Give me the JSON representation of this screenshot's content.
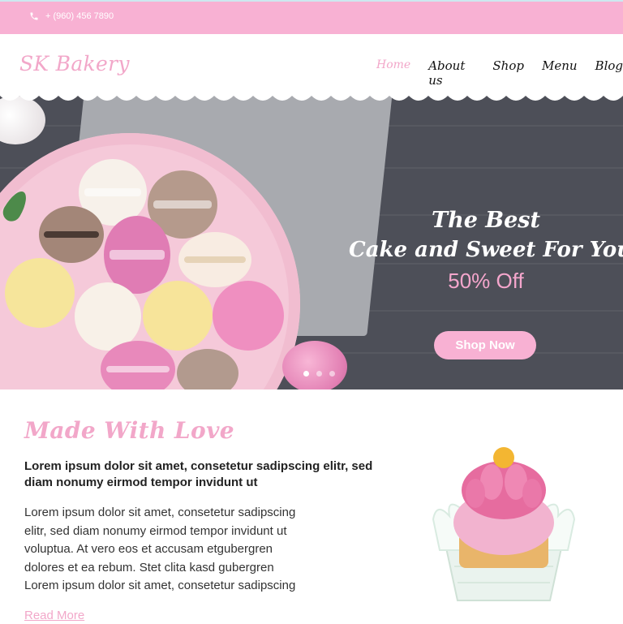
{
  "topbar": {
    "phone": "+ (960) 456 7890",
    "phone_icon": "phone-icon",
    "bg_color": "#f8b1d3"
  },
  "header": {
    "logo": "SK Bakery",
    "nav": [
      {
        "label": "Home",
        "active": true
      },
      {
        "label": "About us",
        "active": false
      },
      {
        "label": "Shop",
        "active": false
      },
      {
        "label": "Menu",
        "active": false
      },
      {
        "label": "Blog",
        "active": false
      }
    ]
  },
  "hero": {
    "line1": "The Best",
    "line2": "Cake and Sweet For You",
    "offer": "50% Off",
    "button": "Shop Now",
    "slide_count": 3,
    "active_slide": 1,
    "accent_color": "#f4a6cc"
  },
  "about": {
    "title": "Made With Love",
    "lead": "Lorem ipsum dolor sit amet, consetetur sadipscing elitr, sed diam nonumy eirmod tempor invidunt ut",
    "body_lines": [
      "Lorem ipsum dolor sit amet, consetetur sadipscing",
      "elitr, sed diam nonumy eirmod tempor invidunt ut",
      "voluptua. At vero eos et accusam etgubergren",
      "dolores et ea rebum. Stet clita kasd gubergren",
      "Lorem ipsum dolor sit amet, consetetur sadipscing"
    ],
    "read_more": "Read More"
  }
}
